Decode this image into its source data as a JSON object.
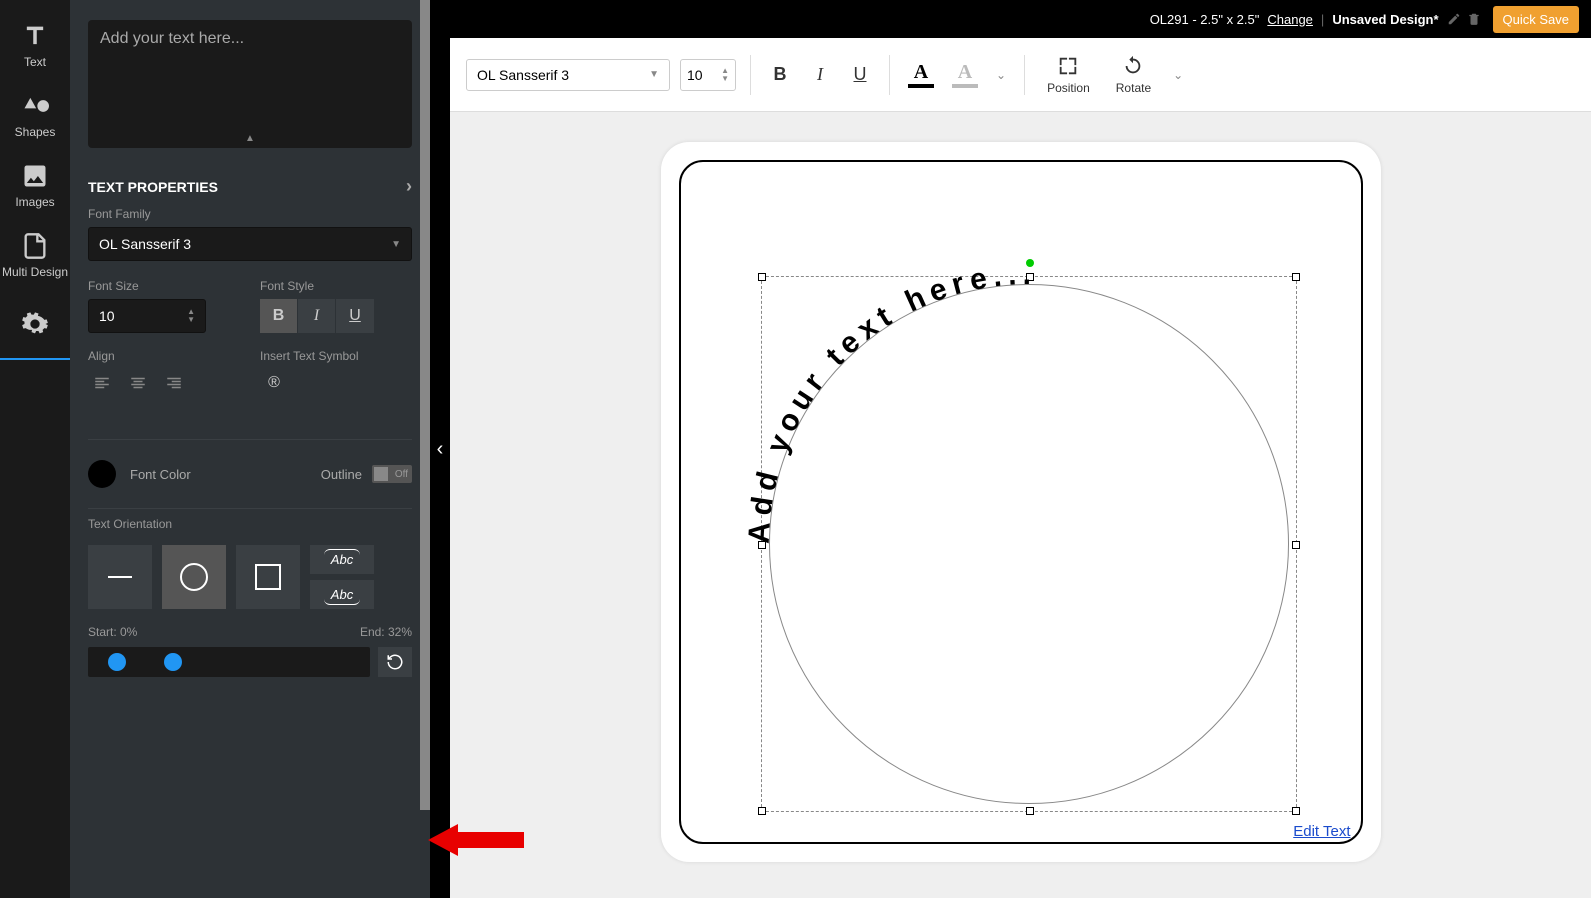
{
  "topbar": {
    "product": "OL291 - 2.5\" x 2.5\"",
    "change": "Change",
    "title": "Unsaved Design*",
    "quick_save": "Quick Save"
  },
  "toolbar": {
    "font": "OL Sansserif 3",
    "size": "10",
    "bold": "B",
    "italic": "I",
    "underline": "U",
    "text_color": "A",
    "outline_color": "A",
    "position": "Position",
    "rotate": "Rotate"
  },
  "sidebar": {
    "items": [
      {
        "label": "Text"
      },
      {
        "label": "Shapes"
      },
      {
        "label": "Images"
      },
      {
        "label": "Multi Design"
      },
      {
        "label": ""
      }
    ]
  },
  "panel": {
    "placeholder": "Add your text here...",
    "header": "TEXT PROPERTIES",
    "font_family_label": "Font Family",
    "font_family": "OL Sansserif 3",
    "font_size_label": "Font Size",
    "font_size": "10",
    "font_style_label": "Font Style",
    "bold": "B",
    "italic": "I",
    "underline": "U",
    "align_label": "Align",
    "symbol_label": "Insert Text Symbol",
    "symbol": "®",
    "font_color_label": "Font Color",
    "outline_label": "Outline",
    "outline_off": "Off",
    "orientation_label": "Text Orientation",
    "abc": "Abc",
    "start_label": "Start: 0%",
    "end_label": "End: 32%"
  },
  "canvas": {
    "text": "Add your text here...",
    "edit_link": "Edit Text"
  }
}
